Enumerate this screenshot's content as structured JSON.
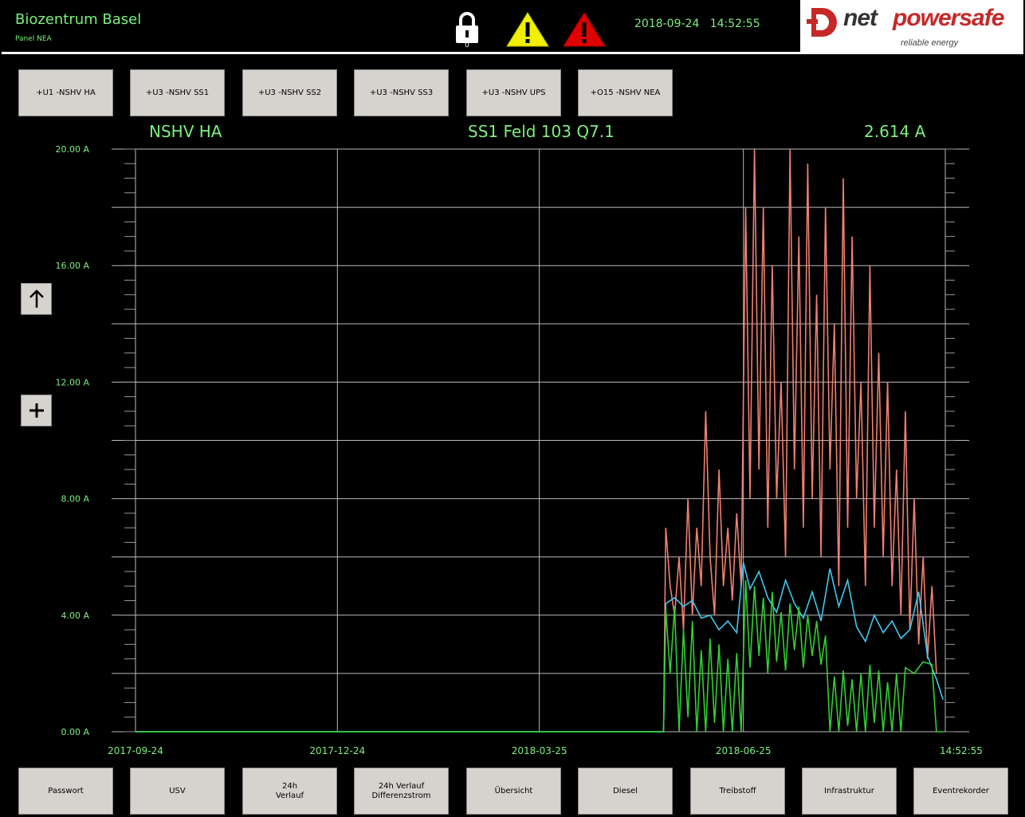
{
  "header": {
    "app_title": "Biozentrum Basel",
    "panel_name": "Panel NEA",
    "lock_count": "0",
    "date": "2018-09-24",
    "time": "14:52:55",
    "lock_icon": "lock-icon",
    "warning_icons": [
      "warning-yellow-icon",
      "warning-red-icon"
    ],
    "warning_colors": [
      "#f0f000",
      "#e00000"
    ]
  },
  "logo": {
    "word1": "net",
    "word2": "powersafe",
    "tagline": "reliable energy",
    "accent": "#c62828"
  },
  "top_buttons": [
    "+U1 -NSHV HA",
    "+U3 -NSHV SS1",
    "+U3 -NSHV SS2",
    "+U3 -NSHV SS3",
    "+U3 -NSHV UPS",
    "+O15 -NSHV NEA"
  ],
  "side_buttons": {
    "up_icon": "arrow-up-icon",
    "zoom_icon": "plus-icon"
  },
  "bottom_buttons": [
    "Passwort",
    "USV",
    "24h\nVerlauf",
    "24h Verlauf\nDifferenzstrom",
    "Übersicht",
    "Diesel",
    "Treibstoff",
    "Infrastruktur",
    "Eventrekorder"
  ],
  "chart_header": {
    "left": "NSHV HA",
    "center": "SS1 Feld 103 Q7.1",
    "right": "2.614 A"
  },
  "chart_data": {
    "type": "line",
    "y_unit": "A",
    "ylim": [
      0,
      20
    ],
    "y_ticks": [
      "20.00 A",
      "16.00 A",
      "12.00 A",
      "8.00 A",
      "4.00 A",
      "0.00 A"
    ],
    "x_ticks": [
      "2017-09-24",
      "2017-12-24",
      "2018-03-25",
      "2018-06-25",
      "14:52:55"
    ],
    "x_range": [
      "2017-09-24",
      "2018-09-24"
    ],
    "grid": true,
    "series": [
      {
        "color": "#f08070",
        "points": [
          [
            "2017-09-24",
            0
          ],
          [
            "2018-05-20",
            0
          ],
          [
            "2018-05-21",
            7
          ],
          [
            "2018-05-23",
            5
          ],
          [
            "2018-05-25",
            4
          ],
          [
            "2018-05-27",
            6
          ],
          [
            "2018-05-29",
            3.5
          ],
          [
            "2018-05-31",
            8
          ],
          [
            "2018-06-02",
            4
          ],
          [
            "2018-06-04",
            7
          ],
          [
            "2018-06-06",
            5
          ],
          [
            "2018-06-08",
            11
          ],
          [
            "2018-06-10",
            6
          ],
          [
            "2018-06-12",
            4
          ],
          [
            "2018-06-14",
            9
          ],
          [
            "2018-06-16",
            5
          ],
          [
            "2018-06-18",
            7
          ],
          [
            "2018-06-20",
            4.5
          ],
          [
            "2018-06-22",
            7.5
          ],
          [
            "2018-06-24",
            5
          ],
          [
            "2018-06-26",
            18
          ],
          [
            "2018-06-28",
            8
          ],
          [
            "2018-06-30",
            20
          ],
          [
            "2018-07-02",
            9
          ],
          [
            "2018-07-04",
            18
          ],
          [
            "2018-07-06",
            7
          ],
          [
            "2018-07-08",
            16
          ],
          [
            "2018-07-10",
            8
          ],
          [
            "2018-07-12",
            12
          ],
          [
            "2018-07-14",
            6
          ],
          [
            "2018-07-16",
            20
          ],
          [
            "2018-07-18",
            9
          ],
          [
            "2018-07-20",
            17
          ],
          [
            "2018-07-22",
            7
          ],
          [
            "2018-07-24",
            19.5
          ],
          [
            "2018-07-26",
            8
          ],
          [
            "2018-07-28",
            15
          ],
          [
            "2018-07-30",
            6
          ],
          [
            "2018-08-01",
            18
          ],
          [
            "2018-08-03",
            9
          ],
          [
            "2018-08-05",
            14
          ],
          [
            "2018-08-07",
            5
          ],
          [
            "2018-08-09",
            19
          ],
          [
            "2018-08-11",
            7
          ],
          [
            "2018-08-13",
            17
          ],
          [
            "2018-08-15",
            8
          ],
          [
            "2018-08-17",
            12
          ],
          [
            "2018-08-19",
            5
          ],
          [
            "2018-08-21",
            16
          ],
          [
            "2018-08-23",
            7
          ],
          [
            "2018-08-25",
            13
          ],
          [
            "2018-08-27",
            6
          ],
          [
            "2018-08-29",
            12
          ],
          [
            "2018-08-31",
            5
          ],
          [
            "2018-09-02",
            9
          ],
          [
            "2018-09-04",
            4
          ],
          [
            "2018-09-06",
            11
          ],
          [
            "2018-09-08",
            3.5
          ],
          [
            "2018-09-10",
            8
          ],
          [
            "2018-09-12",
            3
          ],
          [
            "2018-09-14",
            6
          ],
          [
            "2018-09-16",
            2.5
          ],
          [
            "2018-09-18",
            5
          ],
          [
            "2018-09-20",
            2
          ]
        ]
      },
      {
        "color": "#40c8f0",
        "points": [
          [
            "2017-09-24",
            0
          ],
          [
            "2018-05-20",
            0
          ],
          [
            "2018-05-21",
            4.4
          ],
          [
            "2018-05-25",
            4.6
          ],
          [
            "2018-05-29",
            4.3
          ],
          [
            "2018-06-02",
            4.5
          ],
          [
            "2018-06-06",
            3.9
          ],
          [
            "2018-06-10",
            4.0
          ],
          [
            "2018-06-14",
            3.5
          ],
          [
            "2018-06-18",
            3.8
          ],
          [
            "2018-06-22",
            3.4
          ],
          [
            "2018-06-25",
            5.8
          ],
          [
            "2018-06-28",
            4.9
          ],
          [
            "2018-07-02",
            5.5
          ],
          [
            "2018-07-06",
            4.6
          ],
          [
            "2018-07-10",
            4.1
          ],
          [
            "2018-07-14",
            5.2
          ],
          [
            "2018-07-18",
            4.4
          ],
          [
            "2018-07-22",
            3.9
          ],
          [
            "2018-07-26",
            4.8
          ],
          [
            "2018-07-30",
            3.8
          ],
          [
            "2018-08-03",
            5.6
          ],
          [
            "2018-08-07",
            4.3
          ],
          [
            "2018-08-11",
            5.2
          ],
          [
            "2018-08-15",
            3.6
          ],
          [
            "2018-08-19",
            3.1
          ],
          [
            "2018-08-23",
            4.0
          ],
          [
            "2018-08-27",
            3.4
          ],
          [
            "2018-08-31",
            3.8
          ],
          [
            "2018-09-04",
            3.2
          ],
          [
            "2018-09-08",
            3.5
          ],
          [
            "2018-09-12",
            4.8
          ],
          [
            "2018-09-16",
            2.6
          ],
          [
            "2018-09-20",
            1.8
          ],
          [
            "2018-09-23",
            1.1
          ]
        ]
      },
      {
        "color": "#30d030",
        "points": [
          [
            "2017-09-24",
            0
          ],
          [
            "2018-05-20",
            0
          ],
          [
            "2018-05-21",
            4.2
          ],
          [
            "2018-05-23",
            2.0
          ],
          [
            "2018-05-25",
            4.3
          ],
          [
            "2018-05-27",
            0
          ],
          [
            "2018-05-29",
            3.5
          ],
          [
            "2018-05-31",
            0.5
          ],
          [
            "2018-06-02",
            3.8
          ],
          [
            "2018-06-04",
            0
          ],
          [
            "2018-06-06",
            2.8
          ],
          [
            "2018-06-08",
            0
          ],
          [
            "2018-06-10",
            3.2
          ],
          [
            "2018-06-12",
            0.3
          ],
          [
            "2018-06-14",
            3.0
          ],
          [
            "2018-06-16",
            0
          ],
          [
            "2018-06-18",
            2.5
          ],
          [
            "2018-06-20",
            0
          ],
          [
            "2018-06-22",
            2.7
          ],
          [
            "2018-06-24",
            0
          ],
          [
            "2018-06-26",
            5.2
          ],
          [
            "2018-06-28",
            2.2
          ],
          [
            "2018-06-30",
            5.0
          ],
          [
            "2018-07-02",
            2.6
          ],
          [
            "2018-07-04",
            4.6
          ],
          [
            "2018-07-06",
            2.0
          ],
          [
            "2018-07-08",
            4.8
          ],
          [
            "2018-07-10",
            2.4
          ],
          [
            "2018-07-12",
            4.1
          ],
          [
            "2018-07-14",
            2.1
          ],
          [
            "2018-07-16",
            4.4
          ],
          [
            "2018-07-18",
            2.8
          ],
          [
            "2018-07-20",
            4.3
          ],
          [
            "2018-07-22",
            2.2
          ],
          [
            "2018-07-24",
            4.0
          ],
          [
            "2018-07-26",
            2.6
          ],
          [
            "2018-07-28",
            3.8
          ],
          [
            "2018-07-30",
            2.3
          ],
          [
            "2018-08-01",
            3.3
          ],
          [
            "2018-08-03",
            0
          ],
          [
            "2018-08-05",
            1.9
          ],
          [
            "2018-08-07",
            0
          ],
          [
            "2018-08-09",
            2.1
          ],
          [
            "2018-08-11",
            0.2
          ],
          [
            "2018-08-13",
            1.8
          ],
          [
            "2018-08-15",
            0
          ],
          [
            "2018-08-17",
            2.0
          ],
          [
            "2018-08-19",
            0
          ],
          [
            "2018-08-21",
            2.3
          ],
          [
            "2018-08-23",
            0.3
          ],
          [
            "2018-08-25",
            2.1
          ],
          [
            "2018-08-27",
            0
          ],
          [
            "2018-08-29",
            1.7
          ],
          [
            "2018-08-31",
            0
          ],
          [
            "2018-09-02",
            2.0
          ],
          [
            "2018-09-04",
            0
          ],
          [
            "2018-09-06",
            2.2
          ],
          [
            "2018-09-10",
            2.0
          ],
          [
            "2018-09-14",
            2.4
          ],
          [
            "2018-09-18",
            2.3
          ],
          [
            "2018-09-20",
            0
          ],
          [
            "2018-09-23",
            0
          ]
        ]
      }
    ]
  }
}
